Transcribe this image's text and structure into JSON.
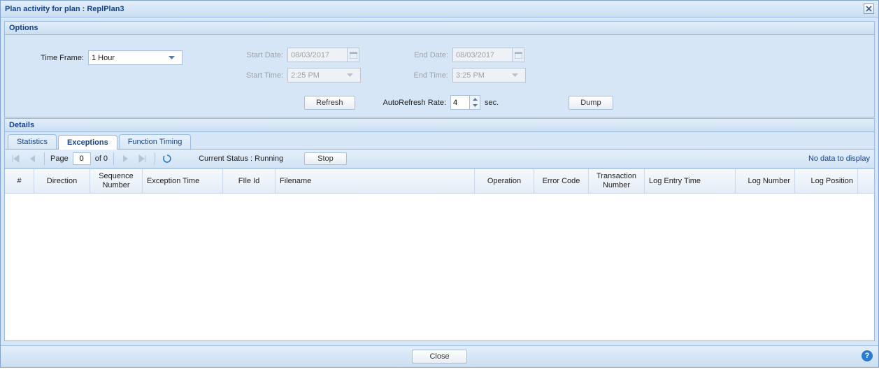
{
  "window": {
    "title": "Plan activity for plan : ReplPlan3"
  },
  "options": {
    "title": "Options",
    "timeFrame": {
      "label": "Time Frame:",
      "value": "1 Hour"
    },
    "startDate": {
      "label": "Start Date:",
      "value": "08/03/2017"
    },
    "endDate": {
      "label": "End Date:",
      "value": "08/03/2017"
    },
    "startTime": {
      "label": "Start Time:",
      "value": "2:25 PM"
    },
    "endTime": {
      "label": "End Time:",
      "value": "3:25 PM"
    },
    "refreshBtn": "Refresh",
    "autoRefreshLabel": "AutoRefresh Rate:",
    "autoRefreshValue": "4",
    "autoRefreshUnit": "sec.",
    "dumpBtn": "Dump"
  },
  "details": {
    "title": "Details",
    "tabs": {
      "statistics": "Statistics",
      "exceptions": "Exceptions",
      "functionTiming": "Function Timing"
    },
    "pager": {
      "pageLabel": "Page",
      "pageNum": "0",
      "ofLabel": "of 0"
    },
    "currentStatusLabel": "Current Status :",
    "currentStatusValue": "Running",
    "stopBtn": "Stop",
    "noData": "No data to display",
    "columns": {
      "num": "#",
      "direction": "Direction",
      "sequenceNumber": "Sequence Number",
      "exceptionTime": "Exception Time",
      "fileId": "FIle Id",
      "filename": "Filename",
      "operation": "Operation",
      "errorCode": "Error Code",
      "transactionNumber": "Transaction Number",
      "logEntryTime": "Log Entry Time",
      "logNumber": "Log Number",
      "logPosition": "Log Position"
    }
  },
  "footer": {
    "close": "Close"
  }
}
